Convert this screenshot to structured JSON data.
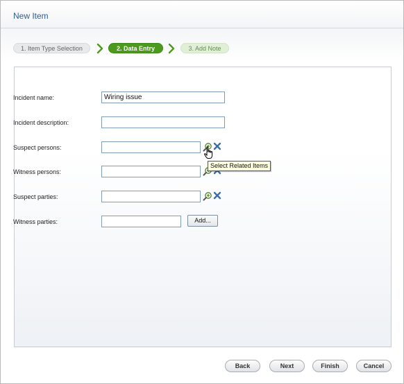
{
  "window": {
    "title": "New Item"
  },
  "steps": [
    {
      "label": "1. Item Type Selection",
      "state": "done"
    },
    {
      "label": "2. Data Entry",
      "state": "active"
    },
    {
      "label": "3. Add Note",
      "state": "upcoming"
    }
  ],
  "form": {
    "incident_name": {
      "label": "Incident name:",
      "value": "Wiring issue"
    },
    "incident_description": {
      "label": "Incident description:",
      "value": ""
    },
    "suspect_persons": {
      "label": "Suspect persons:",
      "value": ""
    },
    "witness_persons": {
      "label": "Witness persons:",
      "value": ""
    },
    "suspect_parties": {
      "label": "Suspect parties:",
      "value": ""
    },
    "witness_parties": {
      "label": "Witness parties:",
      "value": "",
      "add_label": "Add..."
    }
  },
  "tooltip": {
    "text": "Select Related Items"
  },
  "footer": {
    "back_label": "Back",
    "next_label": "Next",
    "finish_label": "Finish",
    "cancel_label": "Cancel"
  },
  "colors": {
    "title": "#2e5b94",
    "active_step": "#4c9a1d",
    "step_arrow": "#4c9a1d",
    "remove_icon": "#3a6ea5"
  },
  "icons": [
    "chevron-right-icon",
    "search-related-icon",
    "remove-x-icon",
    "hand-pointer-icon"
  ]
}
